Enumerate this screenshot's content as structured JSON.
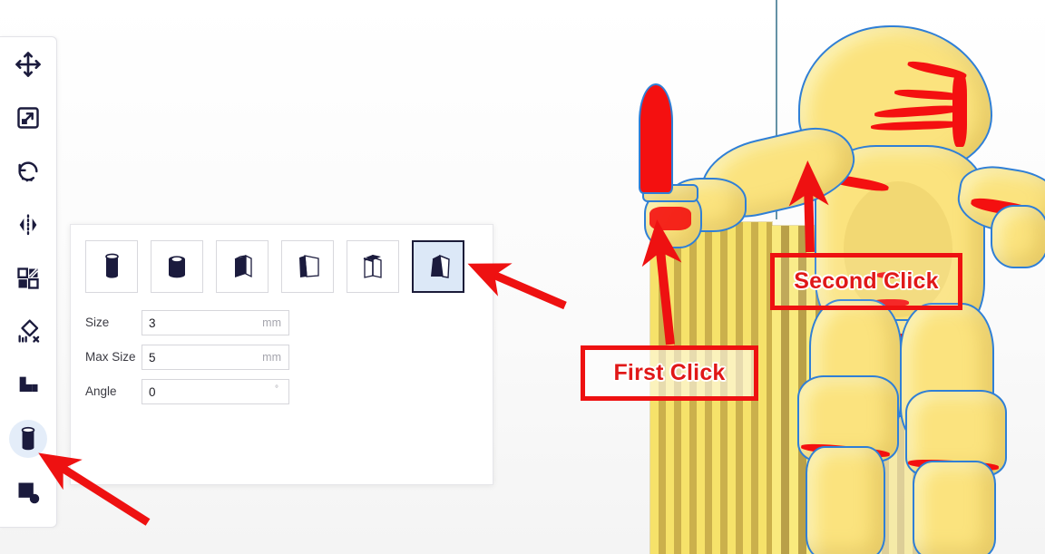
{
  "app": {
    "name": "3d-print-slicer-support-editor"
  },
  "tool_rail": {
    "items": [
      {
        "id": "move",
        "icon": "move-icon",
        "label": "Move",
        "active": false
      },
      {
        "id": "scale",
        "icon": "scale-icon",
        "label": "Scale",
        "active": false
      },
      {
        "id": "rotate",
        "icon": "rotate-icon",
        "label": "Rotate",
        "active": false
      },
      {
        "id": "mirror",
        "icon": "mirror-icon",
        "label": "Mirror",
        "active": false
      },
      {
        "id": "hollow",
        "icon": "hollow-icon",
        "label": "Hollow",
        "active": false
      },
      {
        "id": "remove-supports",
        "icon": "remove-supports-icon",
        "label": "Remove Supports",
        "active": false
      },
      {
        "id": "raft",
        "icon": "raft-icon",
        "label": "Raft",
        "active": false
      },
      {
        "id": "supports",
        "icon": "support-cylinder-icon",
        "label": "Supports",
        "active": true
      },
      {
        "id": "punch",
        "icon": "punch-icon",
        "label": "Punch",
        "active": false
      }
    ]
  },
  "panel": {
    "shapes": [
      {
        "id": "cylinder",
        "icon": "cylinder-icon",
        "label": "Cylinder",
        "selected": false
      },
      {
        "id": "tube",
        "icon": "tube-icon",
        "label": "Tube",
        "selected": false
      },
      {
        "id": "box",
        "icon": "box-icon",
        "label": "Box",
        "selected": false
      },
      {
        "id": "skate",
        "icon": "skate-icon",
        "label": "Skate",
        "selected": false
      },
      {
        "id": "cross",
        "icon": "cross-plate-icon",
        "label": "Cross",
        "selected": false
      },
      {
        "id": "wedge",
        "icon": "wedge-icon",
        "label": "Wedge",
        "selected": true
      }
    ],
    "fields": [
      {
        "id": "size",
        "label": "Size",
        "value": "3",
        "unit": "mm"
      },
      {
        "id": "max-size",
        "label": "Max Size",
        "value": "5",
        "unit": "mm"
      },
      {
        "id": "angle",
        "label": "Angle",
        "value": "0",
        "unit": "°"
      }
    ]
  },
  "annotations": {
    "first_click": "First Click",
    "second_click": "Second Click"
  },
  "colors": {
    "annotation_red": "#ee1111",
    "selected_tile": "#dce8f7",
    "active_halo": "#e4edf9",
    "icon_navy": "#1b1b3d",
    "model_yellow": "#fbe37e",
    "model_outline_blue": "#2f7fd6",
    "overhang_red": "#f41010",
    "axis_teal": "#4a7f96"
  }
}
